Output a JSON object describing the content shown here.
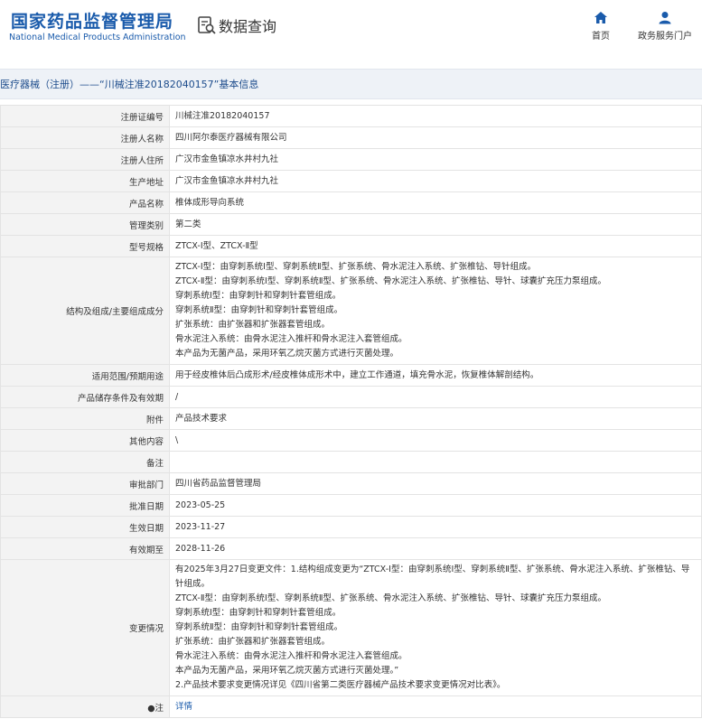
{
  "header": {
    "brand_cn": "国家药品监督管理局",
    "brand_en": "National Medical Products Administration",
    "query_label": "数据查询",
    "nav": [
      {
        "label": "首页",
        "icon": "home-icon"
      },
      {
        "label": "政务服务门户",
        "icon": "user-icon"
      }
    ]
  },
  "title_bar": "医疗器械（注册）——“川械注准20182040157”基本信息",
  "rows": [
    {
      "label": "注册证编号",
      "value": "川械注准20182040157"
    },
    {
      "label": "注册人名称",
      "value": "四川阿尔泰医疗器械有限公司"
    },
    {
      "label": "注册人住所",
      "value": "广汉市金鱼镇凉水井村九社"
    },
    {
      "label": "生产地址",
      "value": "广汉市金鱼镇凉水井村九社"
    },
    {
      "label": "产品名称",
      "value": "椎体成形导向系统"
    },
    {
      "label": "管理类别",
      "value": "第二类"
    },
    {
      "label": "型号规格",
      "value": "ZTCX-Ⅰ型、ZTCX-Ⅱ型"
    },
    {
      "label": "结构及组成/主要组成成分",
      "lines": [
        "ZTCX-Ⅰ型：由穿刺系统Ⅰ型、穿刺系统Ⅱ型、扩张系统、骨水泥注入系统、扩张椎钻、导针组成。",
        "ZTCX-Ⅱ型：由穿刺系统Ⅰ型、穿刺系统Ⅱ型、扩张系统、骨水泥注入系统、扩张椎钻、导针、球囊扩充压力泵组成。",
        "穿刺系统Ⅰ型：由穿刺针和穿刺针套管组成。",
        "穿刺系统Ⅱ型：由穿刺针和穿刺针套管组成。",
        "扩张系统：由扩张器和扩张器套管组成。",
        "骨水泥注入系统：由骨水泥注入推杆和骨水泥注入套管组成。",
        "本产品为无菌产品，采用环氧乙烷灭菌方式进行灭菌处理。"
      ]
    },
    {
      "label": "适用范围/预期用途",
      "value": "用于经皮椎体后凸成形术/经皮椎体成形术中，建立工作通道，填充骨水泥，恢复椎体解剖结构。"
    },
    {
      "label": "产品储存条件及有效期",
      "value": "/"
    },
    {
      "label": "附件",
      "value": "产品技术要求"
    },
    {
      "label": "其他内容",
      "value": "\\"
    },
    {
      "label": "备注",
      "value": ""
    },
    {
      "label": "审批部门",
      "value": "四川省药品监督管理局"
    },
    {
      "label": "批准日期",
      "value": "2023-05-25"
    },
    {
      "label": "生效日期",
      "value": "2023-11-27"
    },
    {
      "label": "有效期至",
      "value": "2028-11-26"
    },
    {
      "label": "变更情况",
      "lines": [
        "有2025年3月27日变更文件：1.结构组成变更为“ZTCX-Ⅰ型：由穿刺系统Ⅰ型、穿刺系统Ⅱ型、扩张系统、骨水泥注入系统、扩张椎钻、导针组成。",
        "ZTCX-Ⅱ型：由穿刺系统Ⅰ型、穿刺系统Ⅱ型、扩张系统、骨水泥注入系统、扩张椎钻、导针、球囊扩充压力泵组成。",
        "穿刺系统Ⅰ型：由穿刺针和穿刺针套管组成。",
        "穿刺系统Ⅱ型：由穿刺针和穿刺针套管组成。",
        "扩张系统：由扩张器和扩张器套管组成。",
        "骨水泥注入系统：由骨水泥注入推杆和骨水泥注入套管组成。",
        "本产品为无菌产品，采用环氧乙烷灭菌方式进行灭菌处理。”",
        "2.产品技术要求变更情况详见《四川省第二类医疗器械产品技术要求变更情况对比表》。"
      ]
    },
    {
      "label": "●注",
      "value": "详情",
      "link": true
    }
  ]
}
